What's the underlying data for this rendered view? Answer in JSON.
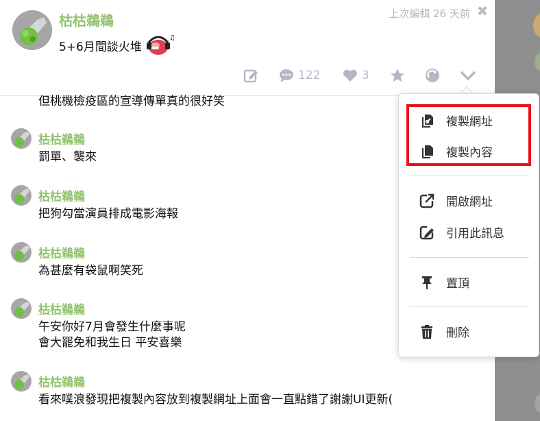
{
  "post": {
    "author": "枯枯鵜鵜",
    "content": "5+6月間談火堆",
    "last_edited": "上次編輯 26 天前",
    "close_label": "✖"
  },
  "actions": {
    "responses_count": "122",
    "likes_count": "3"
  },
  "responses": [
    {
      "author": "",
      "lines": [
        "但桃機檢疫區的宣導傳單真的很好笑"
      ]
    },
    {
      "author": "枯枯鵜鵜",
      "lines": [
        "罰單、襲來"
      ]
    },
    {
      "author": "枯枯鵜鵜",
      "lines": [
        "把狗勾當演員排成電影海報"
      ]
    },
    {
      "author": "枯枯鵜鵜",
      "lines": [
        "為甚麼有袋鼠啊笑死"
      ]
    },
    {
      "author": "枯枯鵜鵜",
      "lines": [
        "午安你好7月會發生什麼事呢",
        "會大罷免和我生日 平安喜樂"
      ]
    },
    {
      "author": "枯枯鵜鵜",
      "lines": [
        "看來噗浪發現把複製內容放到複製網址上面會一直點錯了謝謝UI更新("
      ]
    }
  ],
  "menu": {
    "copy_url": "複製網址",
    "copy_content": "複製內容",
    "open_url": "開啟網址",
    "quote": "引用此訊息",
    "pin": "置頂",
    "delete": "刪除"
  },
  "colors": {
    "author_green": "#93c470",
    "icon_gray": "#b3b9c4",
    "highlight_red": "#e8101a",
    "backdrop": "#8f8f8f"
  },
  "icons": {
    "edit": "edit-icon",
    "responses": "speech-bubble-icon",
    "like": "heart-icon",
    "favorite": "star-icon",
    "replurk": "replurk-icon",
    "more": "chevron-down-icon",
    "copy_url": "copy-link-icon",
    "copy_content": "copy-document-icon",
    "open_url": "external-link-icon",
    "quote": "quote-edit-icon",
    "pin": "pin-icon",
    "delete": "trash-icon"
  }
}
